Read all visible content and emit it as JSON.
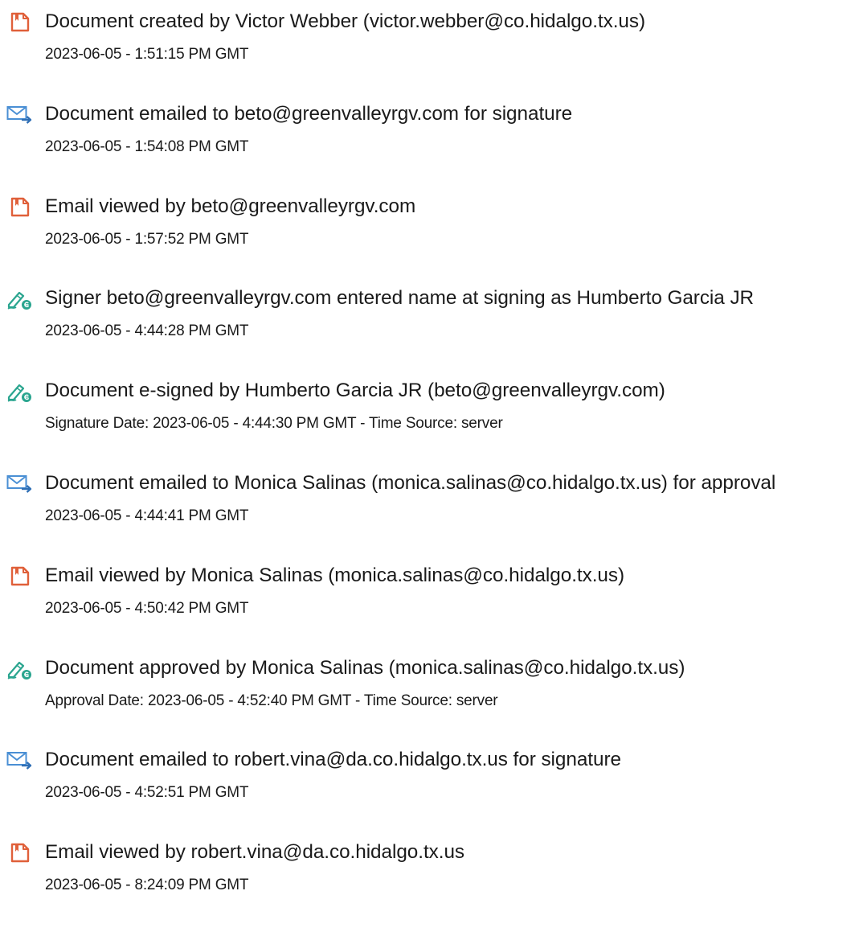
{
  "colors": {
    "document_icon": "#e0603a",
    "email_icon_envelope": "#4a8fd4",
    "email_icon_arrow": "#2f6fb5",
    "sign_icon_pen": "#2aa58f",
    "sign_icon_badge": "#2aa58f",
    "text": "#1a1a1a"
  },
  "events": [
    {
      "icon": "document-icon",
      "title": "Document created by Victor Webber (victor.webber@co.hidalgo.tx.us)",
      "detail": "2023-06-05 - 1:51:15 PM GMT"
    },
    {
      "icon": "email-icon",
      "title": "Document emailed to beto@greenvalleyrgv.com for signature",
      "detail": "2023-06-05 - 1:54:08 PM GMT"
    },
    {
      "icon": "document-icon",
      "title": "Email viewed by beto@greenvalleyrgv.com",
      "detail": "2023-06-05 - 1:57:52 PM GMT"
    },
    {
      "icon": "signature-icon",
      "title": "Signer beto@greenvalleyrgv.com entered name at signing as Humberto Garcia JR",
      "detail": "2023-06-05 - 4:44:28 PM GMT"
    },
    {
      "icon": "signature-icon",
      "title": "Document e-signed by Humberto Garcia JR (beto@greenvalleyrgv.com)",
      "detail": "Signature Date: 2023-06-05 - 4:44:30 PM GMT - Time Source: server"
    },
    {
      "icon": "email-icon",
      "title": "Document emailed to Monica Salinas (monica.salinas@co.hidalgo.tx.us) for approval",
      "detail": "2023-06-05 - 4:44:41 PM GMT"
    },
    {
      "icon": "document-icon",
      "title": "Email viewed by Monica Salinas (monica.salinas@co.hidalgo.tx.us)",
      "detail": "2023-06-05 - 4:50:42 PM GMT"
    },
    {
      "icon": "signature-icon",
      "title": "Document approved by Monica Salinas (monica.salinas@co.hidalgo.tx.us)",
      "detail": "Approval Date: 2023-06-05 - 4:52:40 PM GMT - Time Source: server"
    },
    {
      "icon": "email-icon",
      "title": "Document emailed to robert.vina@da.co.hidalgo.tx.us for signature",
      "detail": "2023-06-05 - 4:52:51 PM GMT"
    },
    {
      "icon": "document-icon",
      "title": "Email viewed by robert.vina@da.co.hidalgo.tx.us",
      "detail": "2023-06-05 - 8:24:09 PM GMT"
    }
  ]
}
